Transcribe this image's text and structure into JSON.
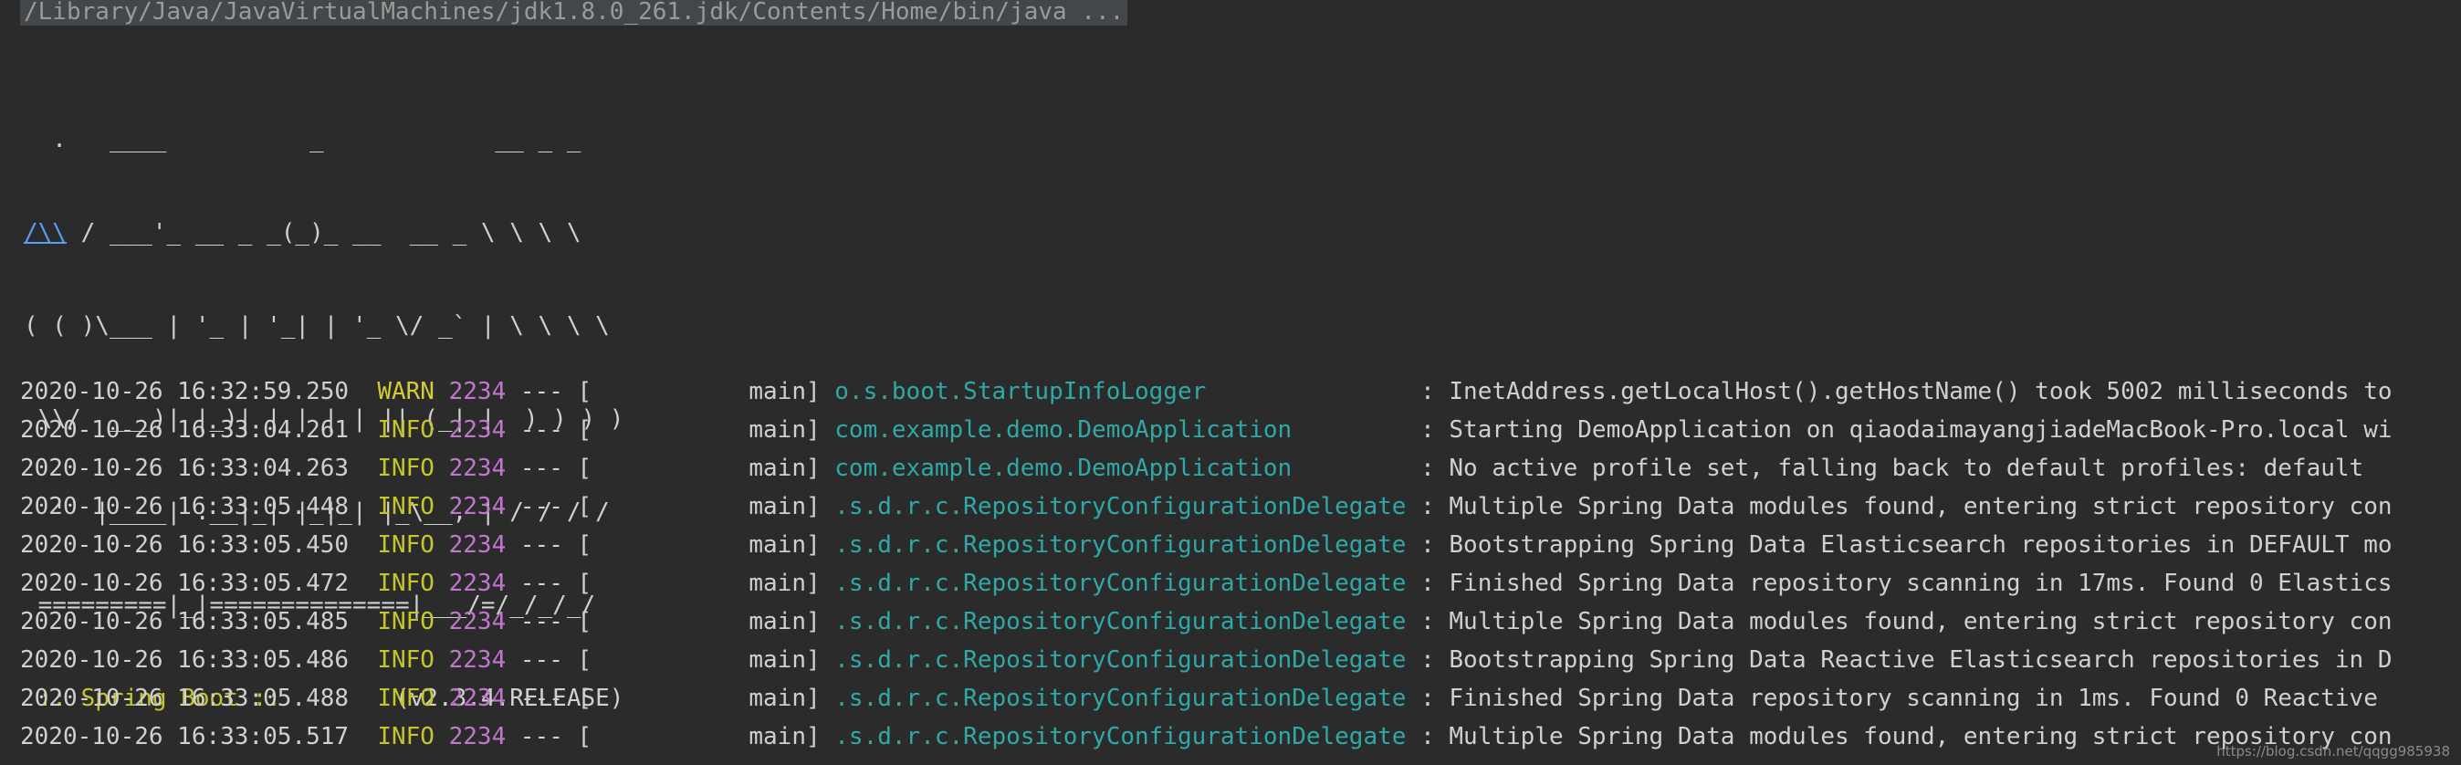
{
  "command": "/Library/Java/JavaVirtualMachines/jdk1.8.0_261.jdk/Contents/Home/bin/java ...",
  "banner": {
    "lines": [
      "  .   ____          _            __ _ _",
      "( ( )\\___ | '_ | '_| | '_ \\/ _` | \\ \\ \\ \\",
      " \\\\/  ___)| |_)| | | | | || (_| |  ) ) ) )",
      "  '  |____| .__|_| |_|_| |_\\__, | / / / /",
      " =========|_|==============|___/=/_/_/_/"
    ],
    "line1_link": "/\\\\",
    "line1_rest": " / ___'_ __ _ _(_)_ __  __ _ \\ \\ \\ \\",
    "boot_label": " :: Spring Boot :: ",
    "boot_version": "       (v2.3.4.RELEASE)"
  },
  "logs": [
    {
      "ts": "2020-10-26 16:32:59.250",
      "level": "WARN",
      "pid": "2234",
      "sep": " --- [           main] ",
      "logger": "o.s.boot.StartupInfoLogger              ",
      "msg": " : InetAddress.getLocalHost().getHostName() took 5002 milliseconds to"
    },
    {
      "ts": "2020-10-26 16:33:04.261",
      "level": "INFO",
      "pid": "2234",
      "sep": " --- [           main] ",
      "logger": "com.example.demo.DemoApplication        ",
      "msg": " : Starting DemoApplication on qiaodaimayangjiadeMacBook-Pro.local wi"
    },
    {
      "ts": "2020-10-26 16:33:04.263",
      "level": "INFO",
      "pid": "2234",
      "sep": " --- [           main] ",
      "logger": "com.example.demo.DemoApplication        ",
      "msg": " : No active profile set, falling back to default profiles: default"
    },
    {
      "ts": "2020-10-26 16:33:05.448",
      "level": "INFO",
      "pid": "2234",
      "sep": " --- [           main] ",
      "logger": ".s.d.r.c.RepositoryConfigurationDelegate",
      "msg": " : Multiple Spring Data modules found, entering strict repository con"
    },
    {
      "ts": "2020-10-26 16:33:05.450",
      "level": "INFO",
      "pid": "2234",
      "sep": " --- [           main] ",
      "logger": ".s.d.r.c.RepositoryConfigurationDelegate",
      "msg": " : Bootstrapping Spring Data Elasticsearch repositories in DEFAULT mo"
    },
    {
      "ts": "2020-10-26 16:33:05.472",
      "level": "INFO",
      "pid": "2234",
      "sep": " --- [           main] ",
      "logger": ".s.d.r.c.RepositoryConfigurationDelegate",
      "msg": " : Finished Spring Data repository scanning in 17ms. Found 0 Elastics"
    },
    {
      "ts": "2020-10-26 16:33:05.485",
      "level": "INFO",
      "pid": "2234",
      "sep": " --- [           main] ",
      "logger": ".s.d.r.c.RepositoryConfigurationDelegate",
      "msg": " : Multiple Spring Data modules found, entering strict repository con"
    },
    {
      "ts": "2020-10-26 16:33:05.486",
      "level": "INFO",
      "pid": "2234",
      "sep": " --- [           main] ",
      "logger": ".s.d.r.c.RepositoryConfigurationDelegate",
      "msg": " : Bootstrapping Spring Data Reactive Elasticsearch repositories in D"
    },
    {
      "ts": "2020-10-26 16:33:05.488",
      "level": "INFO",
      "pid": "2234",
      "sep": " --- [           main] ",
      "logger": ".s.d.r.c.RepositoryConfigurationDelegate",
      "msg": " : Finished Spring Data repository scanning in 1ms. Found 0 Reactive"
    },
    {
      "ts": "2020-10-26 16:33:05.517",
      "level": "INFO",
      "pid": "2234",
      "sep": " --- [           main] ",
      "logger": ".s.d.r.c.RepositoryConfigurationDelegate",
      "msg": " : Multiple Spring Data modules found, entering strict repository con"
    }
  ],
  "watermark": "https://blog.csdn.net/qqgg985938"
}
